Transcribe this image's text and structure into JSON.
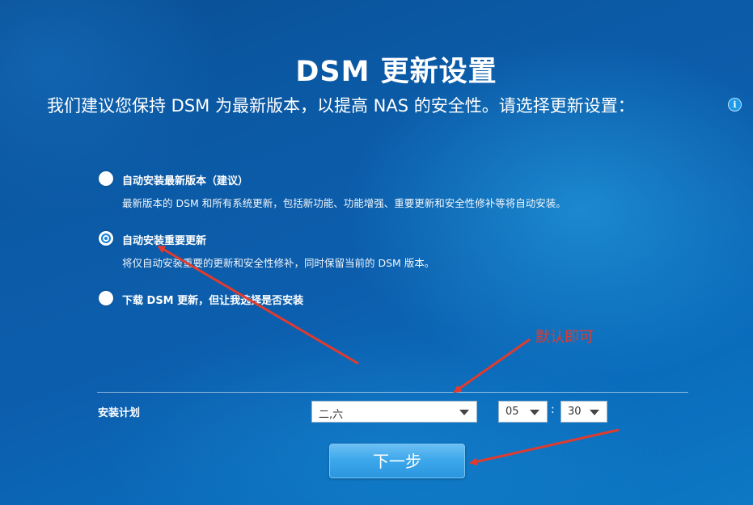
{
  "header": {
    "title": "DSM 更新设置",
    "subtitle": "我们建议您保持 DSM 为最新版本，以提高 NAS 的安全性。请选择更新设置：",
    "info_icon": "info-icon"
  },
  "options": [
    {
      "label": "自动安装最新版本（建议）",
      "description": "最新版本的 DSM 和所有系统更新，包括新功能、功能增强、重要更新和安全性修补等将自动安装。",
      "selected": false
    },
    {
      "label": "自动安装重要更新",
      "description": "将仅自动安装重要的更新和安全性修补，同时保留当前的 DSM 版本。",
      "selected": true
    },
    {
      "label": "下载 DSM 更新，但让我选择是否安装",
      "description": "",
      "selected": false
    }
  ],
  "schedule": {
    "label": "安装计划",
    "days_value": "二,六",
    "hour_value": "05",
    "separator": ":",
    "minute_value": "30"
  },
  "next_button": {
    "label": "下一步"
  },
  "annotation": {
    "text": "默认即可",
    "color": "#e03b2e"
  },
  "colors": {
    "accent": "#1580d8",
    "button": "#3ea8ec",
    "annotation_arrow": "#e03b2e"
  }
}
